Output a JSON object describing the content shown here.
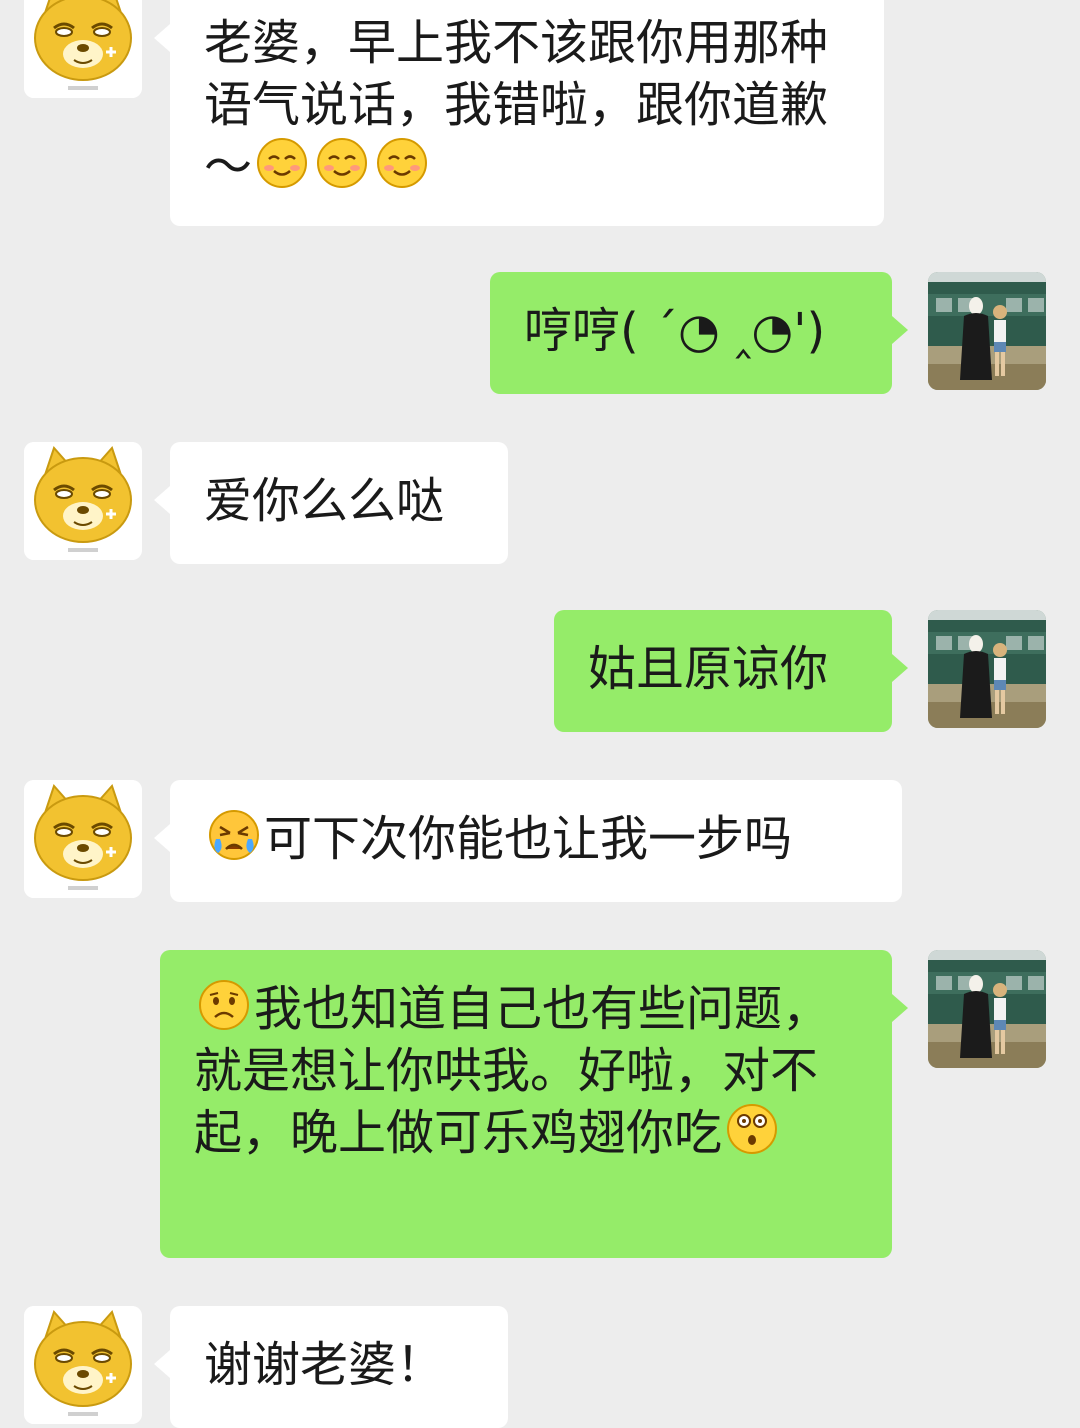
{
  "chat": {
    "messages": [
      {
        "side": "in",
        "text": "老婆，早上我不该跟你用那种语气说话，我错啦，跟你道歉～",
        "trailing_emojis": [
          "smile-blush-icon",
          "smile-blush-icon",
          "smile-blush-icon"
        ]
      },
      {
        "side": "out",
        "text": "哼哼( ´◔ ‸◔')"
      },
      {
        "side": "in",
        "text": "爱你么么哒"
      },
      {
        "side": "out",
        "text": "姑且原谅你"
      },
      {
        "side": "in",
        "lead_emoji": "cry-angry-icon",
        "text": "可下次你能也让我一步吗"
      },
      {
        "side": "out",
        "lead_emoji": "frown-icon",
        "text": "我也知道自己也有些问题，就是想让你哄我。好啦，对不起，晚上做可乐鸡翅你吃",
        "trailing_emojis": [
          "surprised-icon"
        ]
      },
      {
        "side": "in",
        "text": "谢谢老婆！"
      }
    ]
  },
  "colors": {
    "background": "#ededed",
    "incoming_bubble": "#ffffff",
    "outgoing_bubble": "#95ec69",
    "dog_avatar": "#f2c230"
  }
}
